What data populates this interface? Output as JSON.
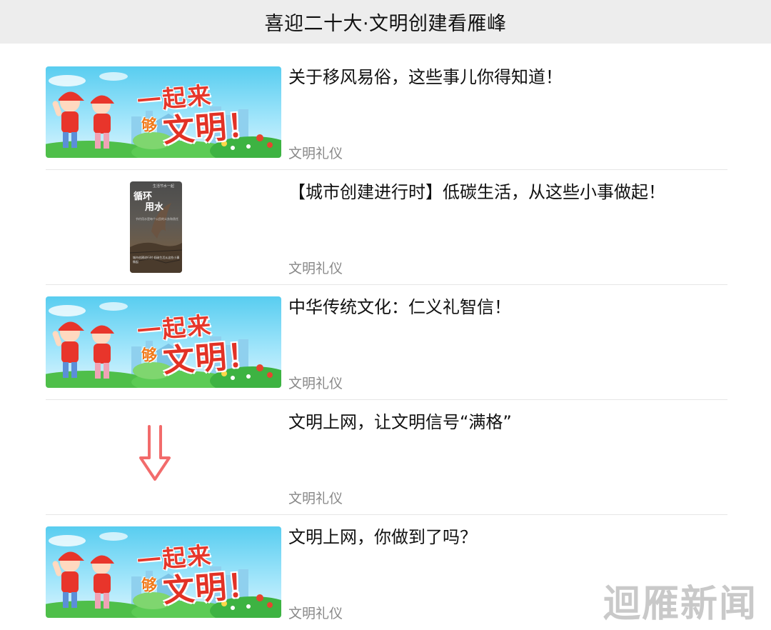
{
  "header": {
    "title": "喜迎二十大·文明创建看雁峰"
  },
  "banner": {
    "line1": "一起来",
    "gou": "够",
    "line2": "文明！"
  },
  "poster": {
    "tag": "生活节水一起",
    "title_line1": "循环",
    "title_line2": "用水",
    "subtitle": "节约用水是每个公民的义务和责任",
    "footer": "城市创建进行时 低碳生活从这些小事做起"
  },
  "articles": [
    {
      "title": "关于移风易俗，这些事儿你得知道！",
      "category": "文明礼仪",
      "thumb": "banner"
    },
    {
      "title": "【城市创建进行时】低碳生活，从这些小事做起！",
      "category": "文明礼仪",
      "thumb": "poster"
    },
    {
      "title": "中华传统文化：仁义礼智信！",
      "category": "文明礼仪",
      "thumb": "banner"
    },
    {
      "title": "文明上网，让文明信号“满格”",
      "category": "文明礼仪",
      "thumb": "arrow-down-icon"
    },
    {
      "title": "文明上网，你做到了吗？",
      "category": "文明礼仪",
      "thumb": "banner"
    }
  ],
  "watermark": "迴雁新闻",
  "colors": {
    "header_bg": "#ededed",
    "category_gray": "#888888",
    "arrow": "#f26b6b",
    "banner_red": "#e23225"
  }
}
